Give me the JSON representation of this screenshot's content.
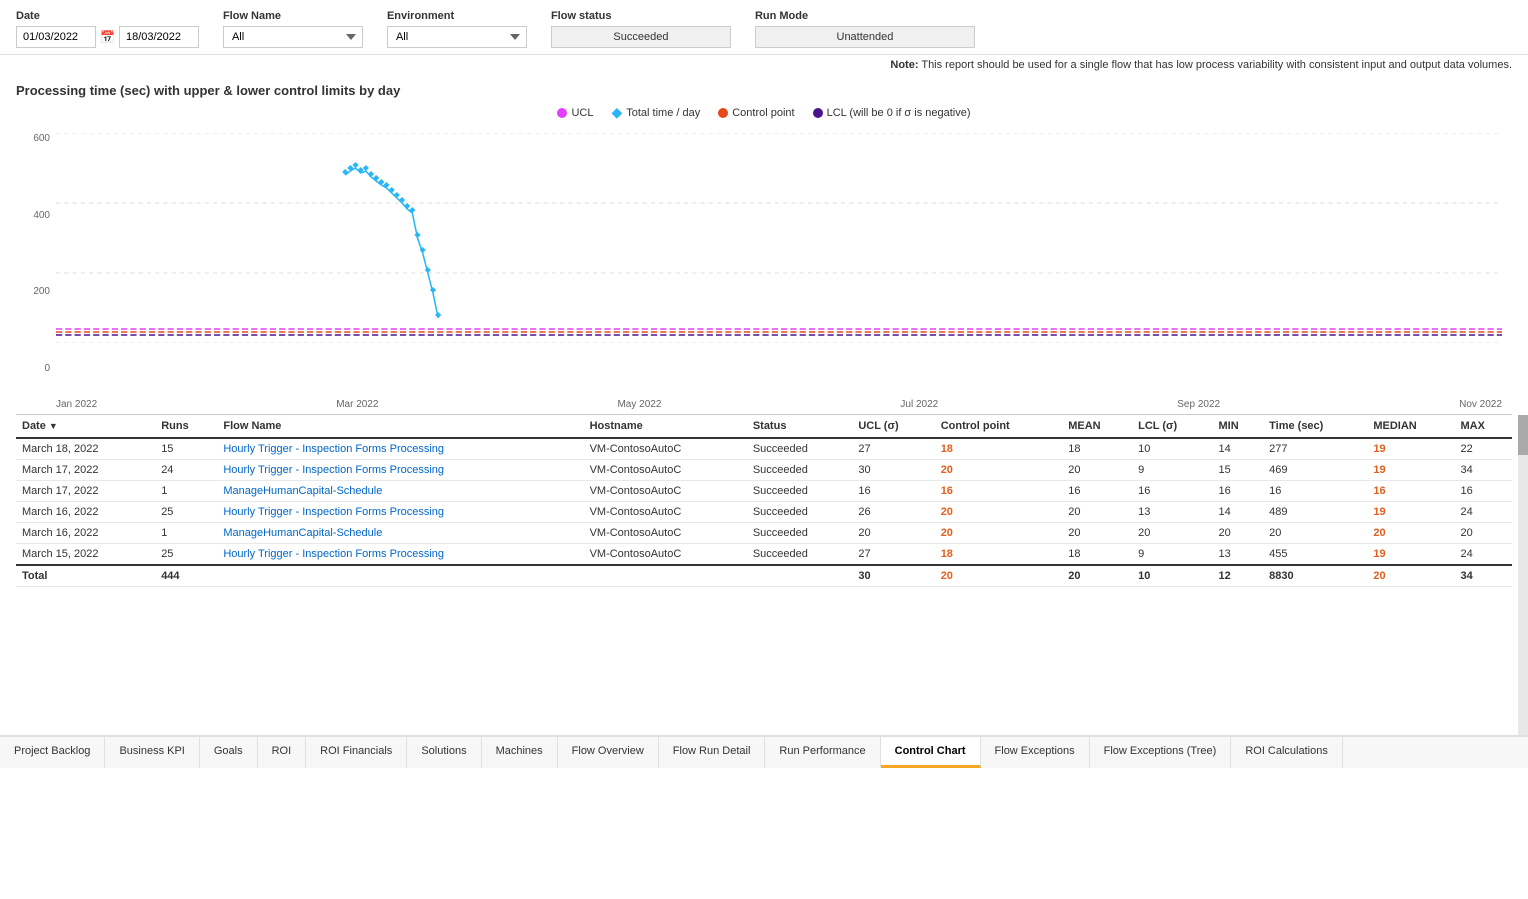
{
  "filters": {
    "date_label": "Date",
    "date_from": "01/03/2022",
    "date_to": "18/03/2022",
    "flow_name_label": "Flow Name",
    "flow_name_value": "All",
    "environment_label": "Environment",
    "environment_value": "All",
    "flow_status_label": "Flow status",
    "flow_status_value": "Succeeded",
    "run_mode_label": "Run Mode",
    "run_mode_value": "Unattended"
  },
  "note": "Note:",
  "note_text": "This report should be used for a single flow that has low process variability with consistent input and output data volumes.",
  "chart": {
    "title": "Processing time (sec) with upper & lower control limits by day",
    "legend": [
      {
        "label": "UCL",
        "color": "#e040fb",
        "shape": "dot"
      },
      {
        "label": "Total time / day",
        "color": "#29b6f6",
        "shape": "diamond"
      },
      {
        "label": "Control point",
        "color": "#e64a19",
        "shape": "dot"
      },
      {
        "label": "LCL (will be 0 if σ is negative)",
        "color": "#4a148c",
        "shape": "dot"
      }
    ],
    "y_labels": [
      "600",
      "400",
      "200",
      "0"
    ],
    "x_labels": [
      "Jan 2022",
      "Mar 2022",
      "May 2022",
      "Jul 2022",
      "Sep 2022",
      "Nov 2022"
    ]
  },
  "table": {
    "columns": [
      "Date",
      "Runs",
      "Flow Name",
      "Hostname",
      "Status",
      "UCL (σ)",
      "Control point",
      "MEAN",
      "LCL (σ)",
      "MIN",
      "Time (sec)",
      "MEDIAN",
      "MAX"
    ],
    "rows": [
      {
        "date": "March 18, 2022",
        "runs": "15",
        "flow_name": "Hourly Trigger - Inspection Forms Processing",
        "hostname": "VM-ContosoAutoC",
        "status": "Succeeded",
        "ucl": "27",
        "control_point": "18",
        "mean": "18",
        "lcl": "10",
        "min": "14",
        "time_sec": "277",
        "median": "19",
        "max": "22"
      },
      {
        "date": "March 17, 2022",
        "runs": "24",
        "flow_name": "Hourly Trigger - Inspection Forms Processing",
        "hostname": "VM-ContosoAutoC",
        "status": "Succeeded",
        "ucl": "30",
        "control_point": "20",
        "mean": "20",
        "lcl": "9",
        "min": "15",
        "time_sec": "469",
        "median": "19",
        "max": "34"
      },
      {
        "date": "March 17, 2022",
        "runs": "1",
        "flow_name": "ManageHumanCapital-Schedule",
        "hostname": "VM-ContosoAutoC",
        "status": "Succeeded",
        "ucl": "16",
        "control_point": "16",
        "mean": "16",
        "lcl": "16",
        "min": "16",
        "time_sec": "16",
        "median": "16",
        "max": "16"
      },
      {
        "date": "March 16, 2022",
        "runs": "25",
        "flow_name": "Hourly Trigger - Inspection Forms Processing",
        "hostname": "VM-ContosoAutoC",
        "status": "Succeeded",
        "ucl": "26",
        "control_point": "20",
        "mean": "20",
        "lcl": "13",
        "min": "14",
        "time_sec": "489",
        "median": "19",
        "max": "24"
      },
      {
        "date": "March 16, 2022",
        "runs": "1",
        "flow_name": "ManageHumanCapital-Schedule",
        "hostname": "VM-ContosoAutoC",
        "status": "Succeeded",
        "ucl": "20",
        "control_point": "20",
        "mean": "20",
        "lcl": "20",
        "min": "20",
        "time_sec": "20",
        "median": "20",
        "max": "20"
      },
      {
        "date": "March 15, 2022",
        "runs": "25",
        "flow_name": "Hourly Trigger - Inspection Forms Processing",
        "hostname": "VM-ContosoAutoC",
        "status": "Succeeded",
        "ucl": "27",
        "control_point": "18",
        "mean": "18",
        "lcl": "9",
        "min": "13",
        "time_sec": "455",
        "median": "19",
        "max": "24"
      }
    ],
    "total": {
      "label": "Total",
      "runs": "444",
      "ucl": "30",
      "control_point": "20",
      "mean": "20",
      "lcl": "10",
      "min": "12",
      "time_sec": "8830",
      "median": "20",
      "max": "34"
    }
  },
  "tabs": [
    {
      "label": "Project Backlog",
      "active": false
    },
    {
      "label": "Business KPI",
      "active": false
    },
    {
      "label": "Goals",
      "active": false
    },
    {
      "label": "ROI",
      "active": false
    },
    {
      "label": "ROI Financials",
      "active": false
    },
    {
      "label": "Solutions",
      "active": false
    },
    {
      "label": "Machines",
      "active": false
    },
    {
      "label": "Flow Overview",
      "active": false
    },
    {
      "label": "Flow Run Detail",
      "active": false
    },
    {
      "label": "Run Performance",
      "active": false
    },
    {
      "label": "Control Chart",
      "active": true
    },
    {
      "label": "Flow Exceptions",
      "active": false
    },
    {
      "label": "Flow Exceptions (Tree)",
      "active": false
    },
    {
      "label": "ROI Calculations",
      "active": false
    }
  ]
}
